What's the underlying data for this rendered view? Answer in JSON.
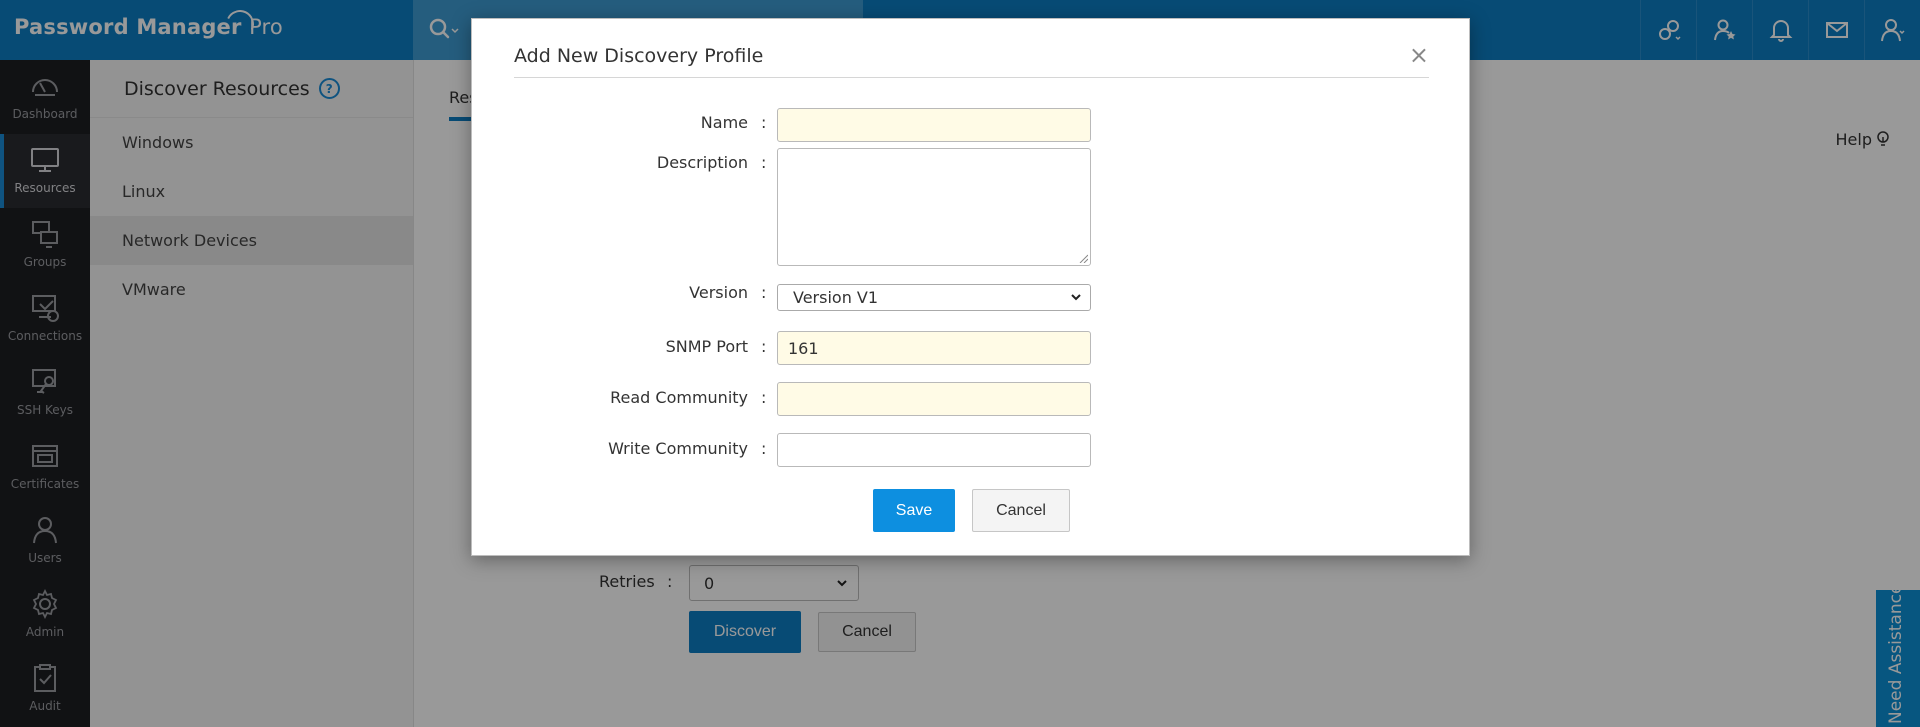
{
  "app": {
    "title": "Password Manager",
    "title_suffix": "Pro"
  },
  "top_icons": [
    "link-settings-icon",
    "favorite-user-icon",
    "bell-icon",
    "mail-icon",
    "user-icon"
  ],
  "leftnav": {
    "items": [
      {
        "label": "Dashboard",
        "icon": "dashboard-icon"
      },
      {
        "label": "Resources",
        "icon": "monitor-icon"
      },
      {
        "label": "Groups",
        "icon": "groups-icon"
      },
      {
        "label": "Connections",
        "icon": "connections-icon"
      },
      {
        "label": "SSH Keys",
        "icon": "ssh-keys-icon"
      },
      {
        "label": "Certificates",
        "icon": "certificates-icon"
      },
      {
        "label": "Users",
        "icon": "users-icon"
      },
      {
        "label": "Admin",
        "icon": "gear-icon"
      },
      {
        "label": "Audit",
        "icon": "audit-icon"
      }
    ],
    "active": "Resources"
  },
  "subpanel": {
    "title": "Discover Resources",
    "help_glyph": "?",
    "items": [
      "Windows",
      "Linux",
      "Network Devices",
      "VMware"
    ],
    "active": "Network Devices"
  },
  "main": {
    "tab_label": "Res",
    "help_label": "Help",
    "retries_label": "Retries",
    "retries_colon": ":",
    "retries_value": "0",
    "discover_label": "Discover",
    "cancel_label": "Cancel"
  },
  "assist_label": "Need Assistance?",
  "modal": {
    "title": "Add New Discovery Profile",
    "close_glyph": "×",
    "fields": {
      "name": {
        "label": "Name",
        "value": ""
      },
      "description": {
        "label": "Description",
        "value": ""
      },
      "version": {
        "label": "Version",
        "value": "Version V1"
      },
      "snmp_port": {
        "label": "SNMP Port",
        "value": "161"
      },
      "read_community": {
        "label": "Read Community",
        "value": ""
      },
      "write_community": {
        "label": "Write Community",
        "value": ""
      }
    },
    "colon": ":",
    "save_label": "Save",
    "cancel_label": "Cancel"
  },
  "colors": {
    "brand_blue": "#0d7ec4",
    "nav_dark": "#1d1e22",
    "input_yellow": "#fffbe6",
    "button_blue": "#0d8fe0"
  }
}
